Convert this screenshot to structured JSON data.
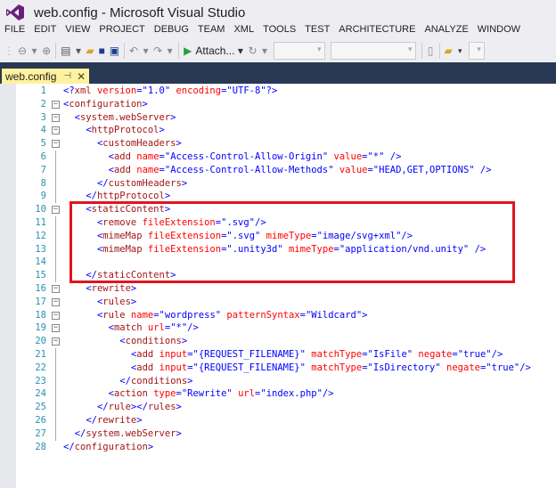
{
  "window": {
    "title": "web.config - Microsoft Visual Studio"
  },
  "menu": [
    "FILE",
    "EDIT",
    "VIEW",
    "PROJECT",
    "DEBUG",
    "TEAM",
    "XML",
    "TOOLS",
    "TEST",
    "ARCHITECTURE",
    "ANALYZE",
    "WINDOW"
  ],
  "toolbar": {
    "attach_label": "Attach..."
  },
  "tab": {
    "label": "web.config",
    "pin": "⊣",
    "close": "✕"
  },
  "fold_marker": "−",
  "colors": {
    "tag": "#0000ff",
    "element": "#a31515",
    "attribute": "#ff0000",
    "value": "#0000ff",
    "highlight": "#e0141e"
  },
  "code_lines": [
    {
      "n": "1",
      "indent": 0,
      "text": "<?xml version=\"1.0\" encoding=\"UTF-8\"?>"
    },
    {
      "n": "2",
      "indent": 0,
      "fold": true,
      "text": "<configuration>"
    },
    {
      "n": "3",
      "indent": 2,
      "fold": true,
      "text": "<system.webServer>"
    },
    {
      "n": "4",
      "indent": 4,
      "fold": true,
      "text": "<httpProtocol>"
    },
    {
      "n": "5",
      "indent": 6,
      "fold": true,
      "text": "<customHeaders>"
    },
    {
      "n": "6",
      "indent": 8,
      "text": "<add name=\"Access-Control-Allow-Origin\" value=\"*\" />"
    },
    {
      "n": "7",
      "indent": 8,
      "text": "<add name=\"Access-Control-Allow-Methods\" value=\"HEAD,GET,OPTIONS\" />"
    },
    {
      "n": "8",
      "indent": 6,
      "text": "</customHeaders>"
    },
    {
      "n": "9",
      "indent": 4,
      "text": "</httpProtocol>"
    },
    {
      "n": "10",
      "indent": 4,
      "fold": true,
      "text": "<staticContent>"
    },
    {
      "n": "11",
      "indent": 6,
      "text": "<remove fileExtension=\".svg\"/>"
    },
    {
      "n": "12",
      "indent": 6,
      "text": "<mimeMap fileExtension=\".svg\" mimeType=\"image/svg+xml\"/>"
    },
    {
      "n": "13",
      "indent": 6,
      "text": "<mimeMap fileExtension=\".unity3d\" mimeType=\"application/vnd.unity\" />"
    },
    {
      "n": "14",
      "indent": 0,
      "text": ""
    },
    {
      "n": "15",
      "indent": 4,
      "text": "</staticContent>"
    },
    {
      "n": "16",
      "indent": 4,
      "fold": true,
      "text": "<rewrite>"
    },
    {
      "n": "17",
      "indent": 6,
      "fold": true,
      "text": "<rules>"
    },
    {
      "n": "18",
      "indent": 6,
      "fold": true,
      "text": "<rule name=\"wordpress\" patternSyntax=\"Wildcard\">"
    },
    {
      "n": "19",
      "indent": 8,
      "fold": true,
      "text": "<match url=\"*\"/>"
    },
    {
      "n": "20",
      "indent": 10,
      "fold": true,
      "text": "<conditions>"
    },
    {
      "n": "21",
      "indent": 12,
      "text": "<add input=\"{REQUEST_FILENAME}\" matchType=\"IsFile\" negate=\"true\"/>"
    },
    {
      "n": "22",
      "indent": 12,
      "text": "<add input=\"{REQUEST_FILENAME}\" matchType=\"IsDirectory\" negate=\"true\"/>"
    },
    {
      "n": "23",
      "indent": 10,
      "text": "</conditions>"
    },
    {
      "n": "24",
      "indent": 8,
      "text": "<action type=\"Rewrite\" url=\"index.php\"/>"
    },
    {
      "n": "25",
      "indent": 6,
      "text": "</rule></rules>"
    },
    {
      "n": "26",
      "indent": 4,
      "text": "</rewrite>"
    },
    {
      "n": "27",
      "indent": 2,
      "text": "</system.webServer>"
    },
    {
      "n": "28",
      "indent": 0,
      "text": "</configuration>"
    }
  ]
}
